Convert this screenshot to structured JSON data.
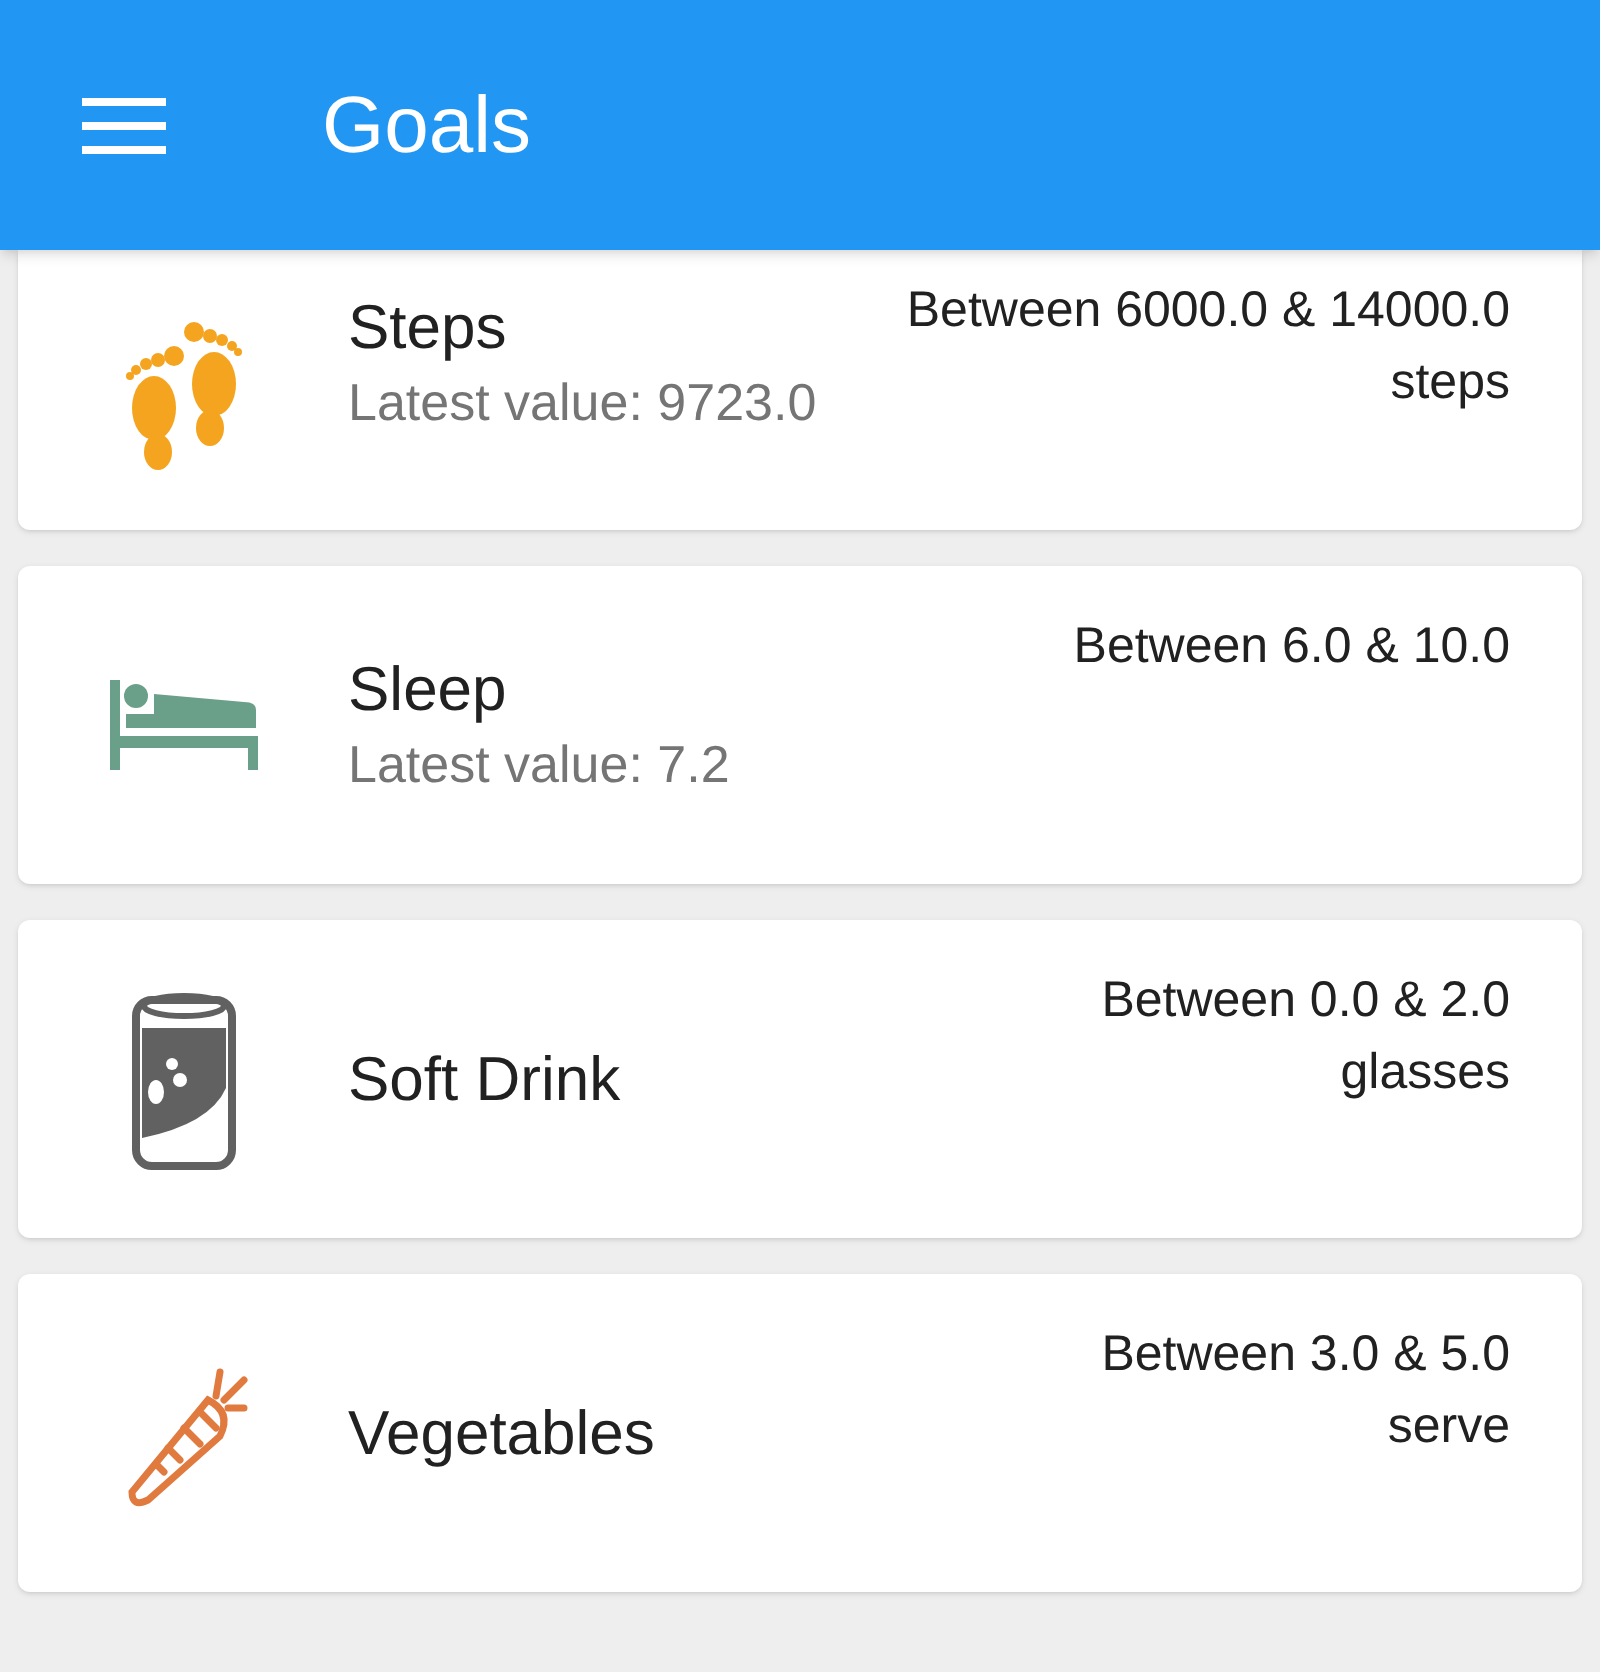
{
  "app_bar": {
    "title": "Goals"
  },
  "goals": [
    {
      "kind": "steps",
      "name": "Steps",
      "latest": "Latest value: 9723.0",
      "range": "Between 6000.0 & 14000.0",
      "unit": "steps"
    },
    {
      "kind": "sleep",
      "name": "Sleep",
      "latest": "Latest value: 7.2",
      "range": "Between 6.0 & 10.0"
    },
    {
      "kind": "drink",
      "name": "Soft Drink",
      "range": "Between 0.0 & 2.0",
      "unit": "glasses"
    },
    {
      "kind": "vegetables",
      "name": "Vegetables",
      "range": "Between 3.0 & 5.0",
      "unit": "serve"
    }
  ]
}
